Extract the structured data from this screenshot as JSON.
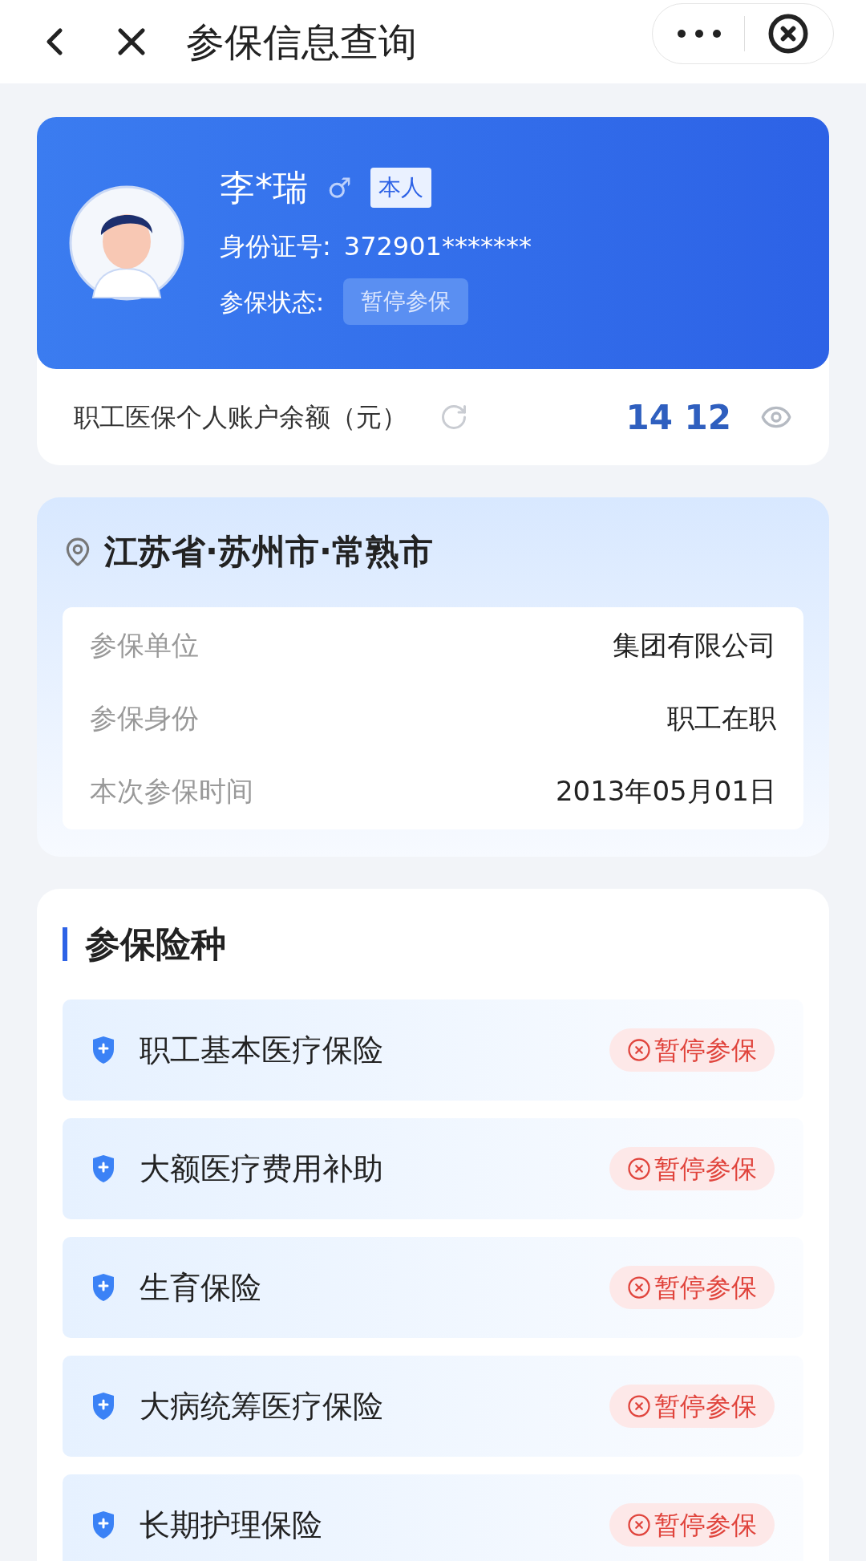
{
  "nav": {
    "title": "参保信息查询"
  },
  "profile": {
    "name": "李*瑞",
    "gender": "♂",
    "relation": "本人",
    "id_label": "身份证号:",
    "id_value": "372901*******",
    "status_label": "参保状态:",
    "status": "暂停参保"
  },
  "balance": {
    "label": "职工医保个人账户余额（元）",
    "value": "14 12"
  },
  "location": {
    "title": "江苏省·苏州市·常熟市",
    "rows": [
      {
        "label": "参保单位",
        "value": "集团有限公司"
      },
      {
        "label": "参保身份",
        "value": "职工在职"
      },
      {
        "label": "本次参保时间",
        "value": "2013年05月01日"
      }
    ]
  },
  "insurance": {
    "heading": "参保险种",
    "items": [
      {
        "name": "职工基本医疗保险",
        "status": "暂停参保",
        "kind": "suspended"
      },
      {
        "name": "大额医疗费用补助",
        "status": "暂停参保",
        "kind": "suspended"
      },
      {
        "name": "生育保险",
        "status": "暂停参保",
        "kind": "suspended"
      },
      {
        "name": "大病统筹医疗保险",
        "status": "暂停参保",
        "kind": "suspended"
      },
      {
        "name": "长期护理保险",
        "status": "暂停参保",
        "kind": "suspended"
      }
    ]
  }
}
